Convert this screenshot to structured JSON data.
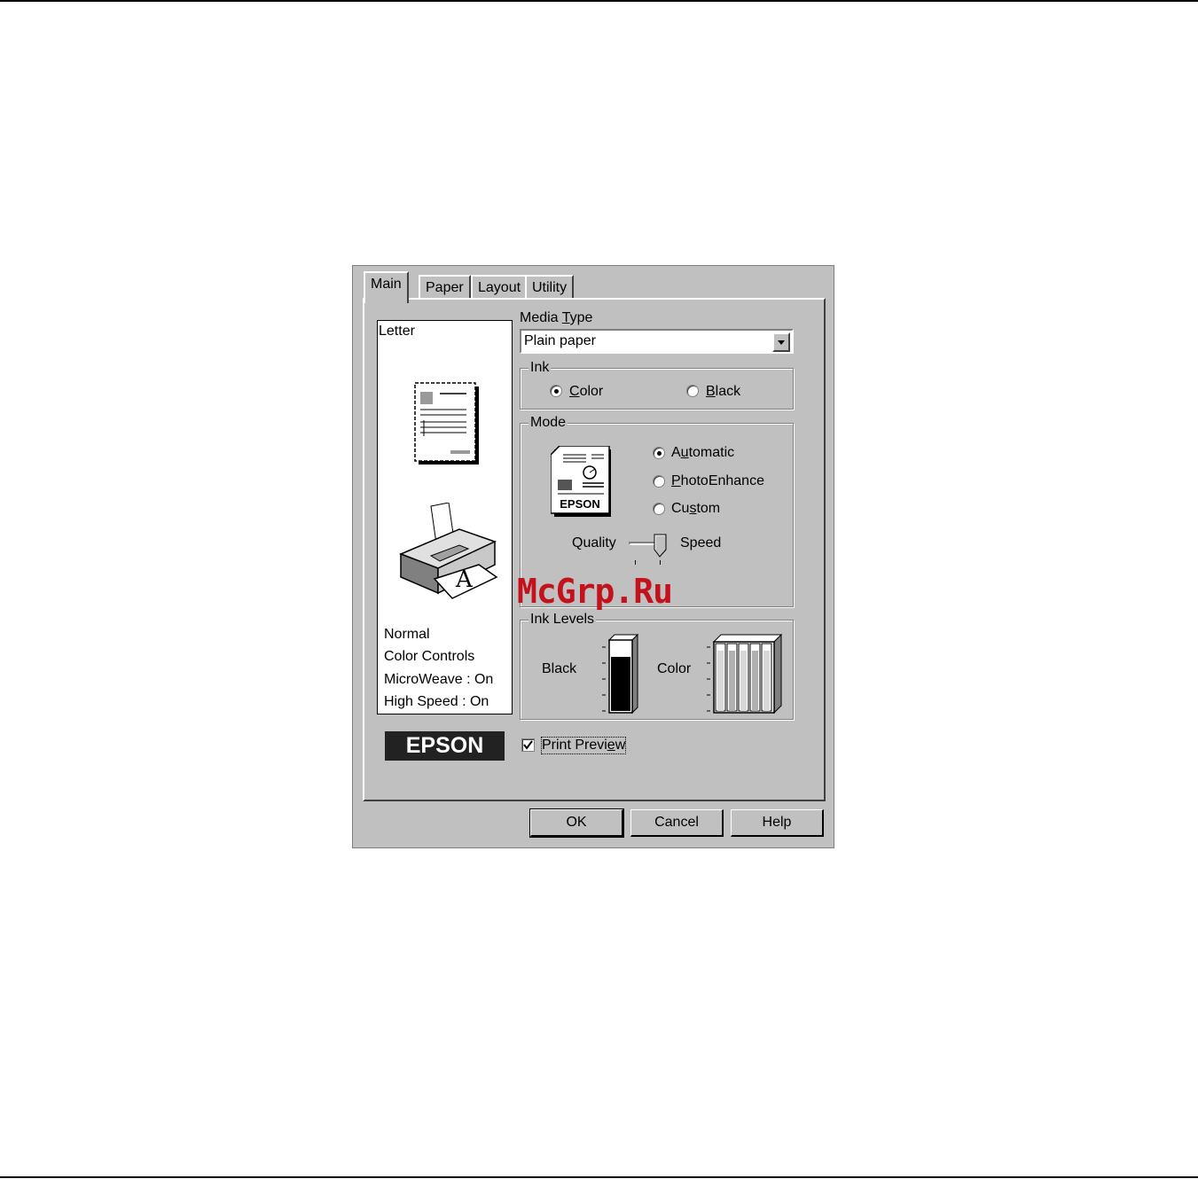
{
  "tabs": [
    {
      "label": "Main"
    },
    {
      "label": "Paper"
    },
    {
      "label": "Layout"
    },
    {
      "label": "Utility"
    }
  ],
  "preview": {
    "paper": "Letter",
    "settings": [
      "Normal",
      "Color Controls",
      "MicroWeave : On",
      "High Speed : On"
    ]
  },
  "media_type": {
    "label": "Media Type",
    "value": "Plain paper"
  },
  "ink": {
    "label": "Ink",
    "options": [
      {
        "label": "Color",
        "selected": true
      },
      {
        "label": "Black",
        "selected": false
      }
    ]
  },
  "mode": {
    "label": "Mode",
    "options": [
      {
        "label": "Automatic",
        "selected": true
      },
      {
        "label": "PhotoEnhance",
        "selected": false
      },
      {
        "label": "Custom",
        "selected": false
      }
    ],
    "icon_text": "EPSON",
    "slider": {
      "left_label": "Quality",
      "right_label": "Speed",
      "position": 1.0
    }
  },
  "ink_levels": {
    "label": "Ink Levels",
    "black_label": "Black",
    "color_label": "Color",
    "black_level": 0.78,
    "color_levels": [
      0.9,
      0.9,
      0.9,
      0.9,
      0.9
    ]
  },
  "brand_logo": "EPSON",
  "print_preview": {
    "label": "Print Preview",
    "checked": true
  },
  "buttons": {
    "ok": "OK",
    "cancel": "Cancel",
    "help": "Help"
  },
  "watermark": "McGrp.Ru",
  "colors": {
    "dialog_bg": "#c0c0c0",
    "watermark": "#c3121c"
  }
}
